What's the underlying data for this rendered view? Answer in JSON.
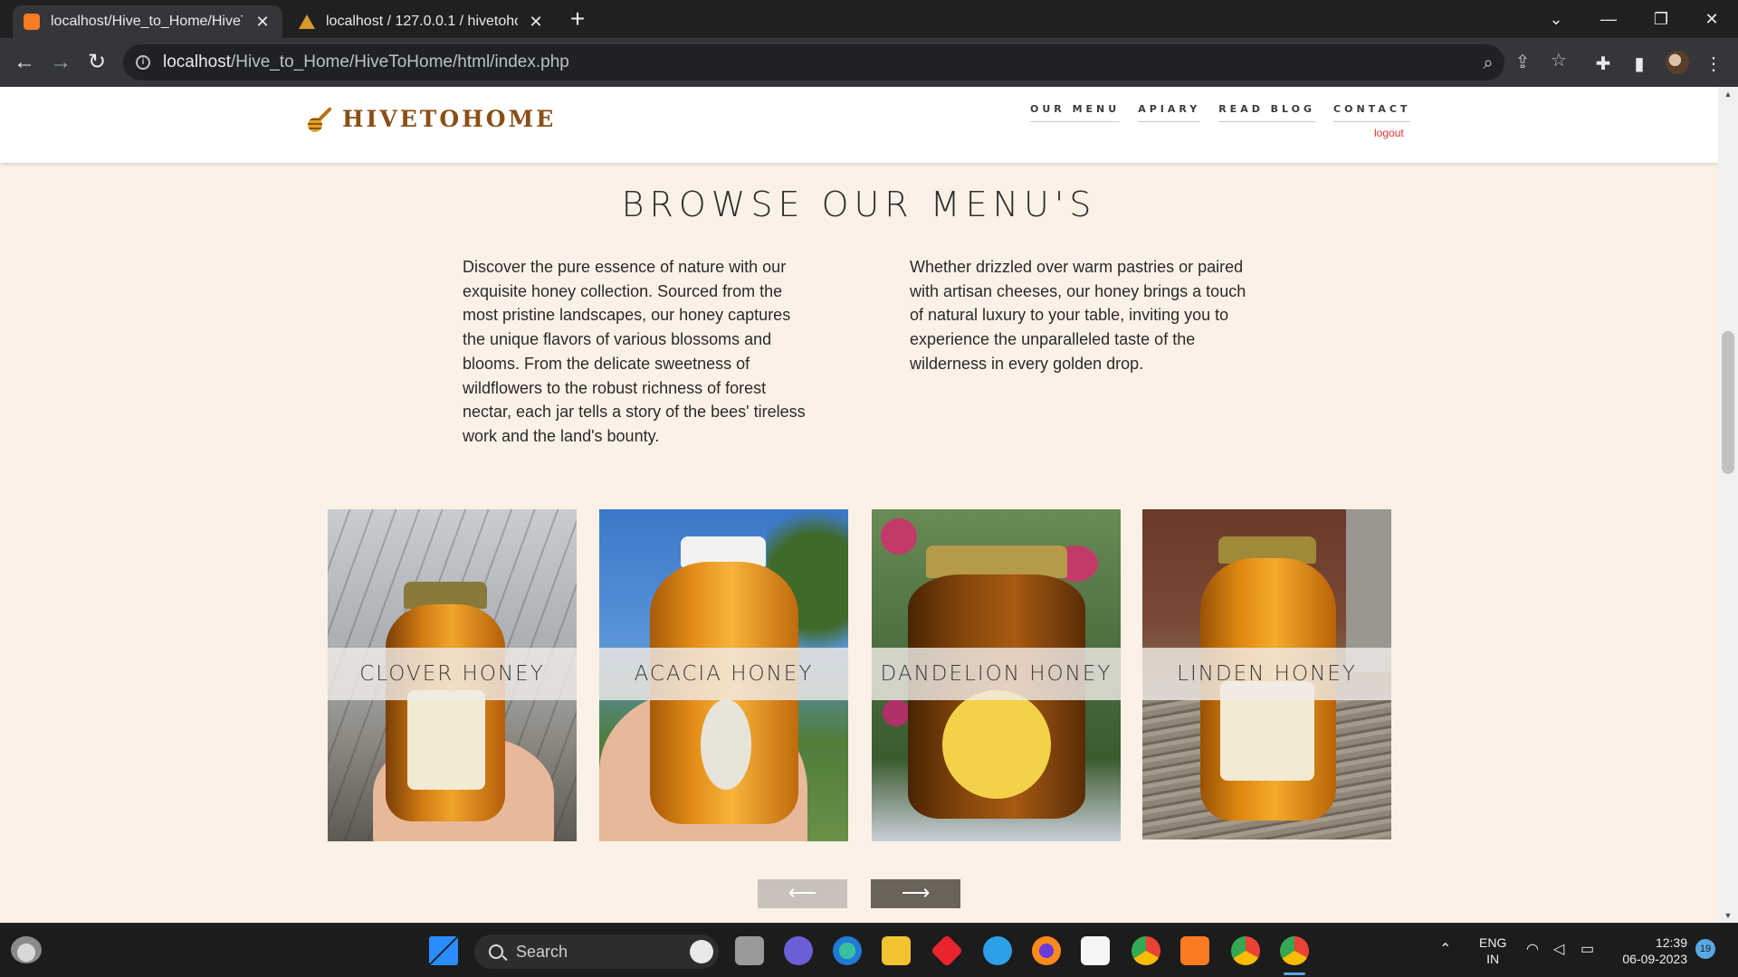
{
  "browser": {
    "tabs": [
      {
        "title": "localhost/Hive_to_Home/HiveToHome/html/index.php",
        "active": true
      },
      {
        "title": "localhost / 127.0.0.1 / hivetohome",
        "active": false
      }
    ],
    "url_host": "localhost",
    "url_path": "/Hive_to_Home/HiveToHome/html/index.php"
  },
  "site": {
    "logo_text": "HIVETOHOME",
    "nav": [
      "OUR MENU",
      "APIARY",
      "READ BLOG",
      "CONTACT"
    ],
    "logout_label": "logout"
  },
  "main": {
    "heading": "BROWSE OUR MENU'S",
    "paragraph_left": "Discover the pure essence of nature with our exquisite honey collection. Sourced from the most pristine landscapes, our honey captures the unique flavors of various blossoms and blooms. From the delicate sweetness of wildflowers to the robust richness of forest nectar, each jar tells a story of the bees' tireless work and the land's bounty.",
    "paragraph_right": "Whether drizzled over warm pastries or paired with artisan cheeses, our honey brings a touch of natural luxury to your table, inviting you to experience the unparalleled taste of the wilderness in every golden drop.",
    "products": [
      {
        "name": "CLOVER HONEY"
      },
      {
        "name": "ACACIA HONEY"
      },
      {
        "name": "DANDELION HONEY"
      },
      {
        "name": "LINDEN HONEY"
      }
    ],
    "prev_label": "⟵",
    "next_label": "⟶"
  },
  "taskbar": {
    "search_label": "Search",
    "lang_line1": "ENG",
    "lang_line2": "IN",
    "time": "12:39",
    "date": "06-09-2023",
    "notification_count": "19"
  }
}
